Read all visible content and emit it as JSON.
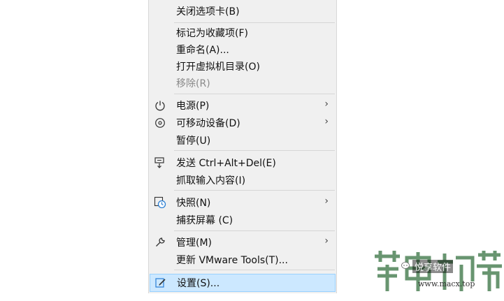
{
  "menu": {
    "items": [
      {
        "label": "关闭选项卡(B)",
        "icon": "",
        "submenu": false,
        "disabled": false
      },
      {
        "label": "标记为收藏项(F)",
        "icon": "",
        "submenu": false,
        "disabled": false
      },
      {
        "label": "重命名(A)...",
        "icon": "",
        "submenu": false,
        "disabled": false
      },
      {
        "label": "打开虚拟机目录(O)",
        "icon": "",
        "submenu": false,
        "disabled": false
      },
      {
        "label": "移除(R)",
        "icon": "",
        "submenu": false,
        "disabled": true
      },
      {
        "label": "电源(P)",
        "icon": "power-icon",
        "submenu": true,
        "disabled": false
      },
      {
        "label": "可移动设备(D)",
        "icon": "removable-device-icon",
        "submenu": true,
        "disabled": false
      },
      {
        "label": "暂停(U)",
        "icon": "",
        "submenu": false,
        "disabled": false
      },
      {
        "label": "发送 Ctrl+Alt+Del(E)",
        "icon": "send-keys-icon",
        "submenu": false,
        "disabled": false
      },
      {
        "label": "抓取输入内容(I)",
        "icon": "",
        "submenu": false,
        "disabled": false
      },
      {
        "label": "快照(N)",
        "icon": "snapshot-icon",
        "submenu": true,
        "disabled": false
      },
      {
        "label": "捕获屏幕 (C)",
        "icon": "",
        "submenu": false,
        "disabled": false
      },
      {
        "label": "管理(M)",
        "icon": "wrench-icon",
        "submenu": true,
        "disabled": false
      },
      {
        "label": "更新 VMware Tools(T)...",
        "icon": "",
        "submenu": false,
        "disabled": false
      },
      {
        "label": "设置(S)...",
        "icon": "settings-icon",
        "submenu": false,
        "disabled": false,
        "highlighted": true
      }
    ],
    "arrow_glyph": "›"
  },
  "watermark": {
    "brand": "悦享软件",
    "url": "www.macx.top"
  },
  "colors": {
    "menu_bg": "#f0f0f0",
    "highlight_bg": "#cce8ff",
    "highlight_border": "#99d1ff",
    "disabled_text": "#8a8a8a"
  }
}
